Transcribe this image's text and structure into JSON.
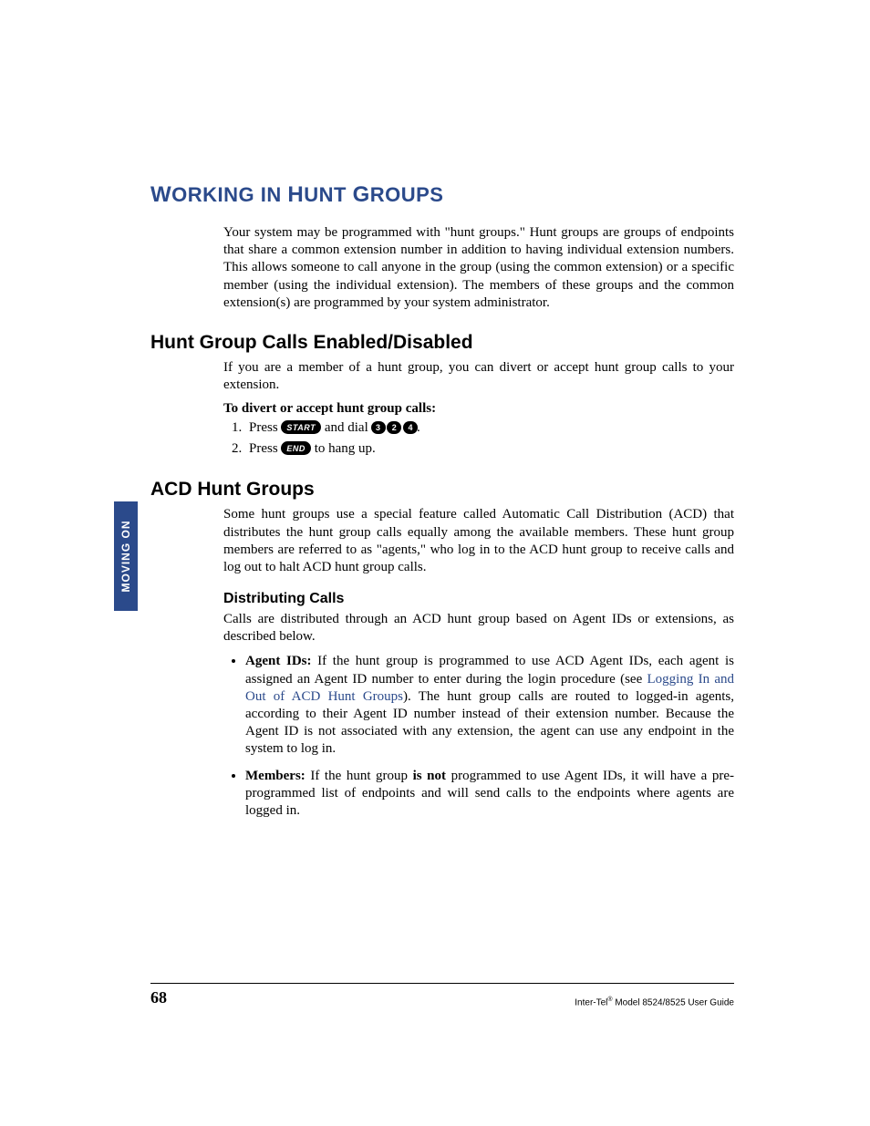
{
  "sideTab": "MOVING ON",
  "heading1": "WORKING IN HUNT GROUPS",
  "intro": "Your system may be programmed with \"hunt groups.\" Hunt groups are groups of endpoints that share a common extension number in addition to having individual extension numbers. This allows someone to call anyone in the group (using the common extension) or a specific member (using the individual extension). The members of these groups and the common extension(s) are programmed by your system administrator.",
  "h2a": "Hunt Group Calls Enabled/Disabled",
  "p2a": "If you are a member of a hunt group, you can divert or accept hunt group calls to your extension.",
  "inst": "To divert or accept hunt group calls:",
  "step1_a": "Press ",
  "btn_start": "START",
  "step1_b": " and dial ",
  "key1": "3",
  "key2": "2",
  "key3": "4",
  "step1_c": ".",
  "step2_a": "Press ",
  "btn_end": "END",
  "step2_b": " to hang up.",
  "h2b": "ACD Hunt Groups",
  "p2b": "Some hunt groups use a special feature called Automatic Call Distribution (ACD) that distributes the hunt group calls equally among the available members. These hunt group members are referred to as \"agents,\" who log in to the ACD hunt group to receive calls and log out to halt ACD hunt group calls.",
  "h3": "Distributing Calls",
  "p3": "Calls are distributed through an ACD hunt group based on Agent IDs or extensions, as described below.",
  "bullet1": {
    "lead": "Agent IDs: ",
    "a": "If the hunt group is programmed to use ACD Agent IDs, each agent is assigned an Agent ID number to enter during the login procedure (see ",
    "link": "Logging In and Out of ACD Hunt Groups",
    "b": "). The hunt group calls are routed to logged-in agents, according to their Agent ID number instead of their extension number. Because the Agent ID is not associated with any extension, the agent can use any endpoint in the system to log in."
  },
  "bullet2": {
    "lead": "Members: ",
    "a": "If the hunt group ",
    "emph": "is not",
    "b": " programmed to use Agent IDs, it will have a pre-programmed list of endpoints and will send calls to the endpoints where agents are logged in."
  },
  "footer": {
    "page": "68",
    "ref_a": "Inter-Tel",
    "ref_sup": "®",
    "ref_b": " Model 8524/8525 User Guide"
  }
}
